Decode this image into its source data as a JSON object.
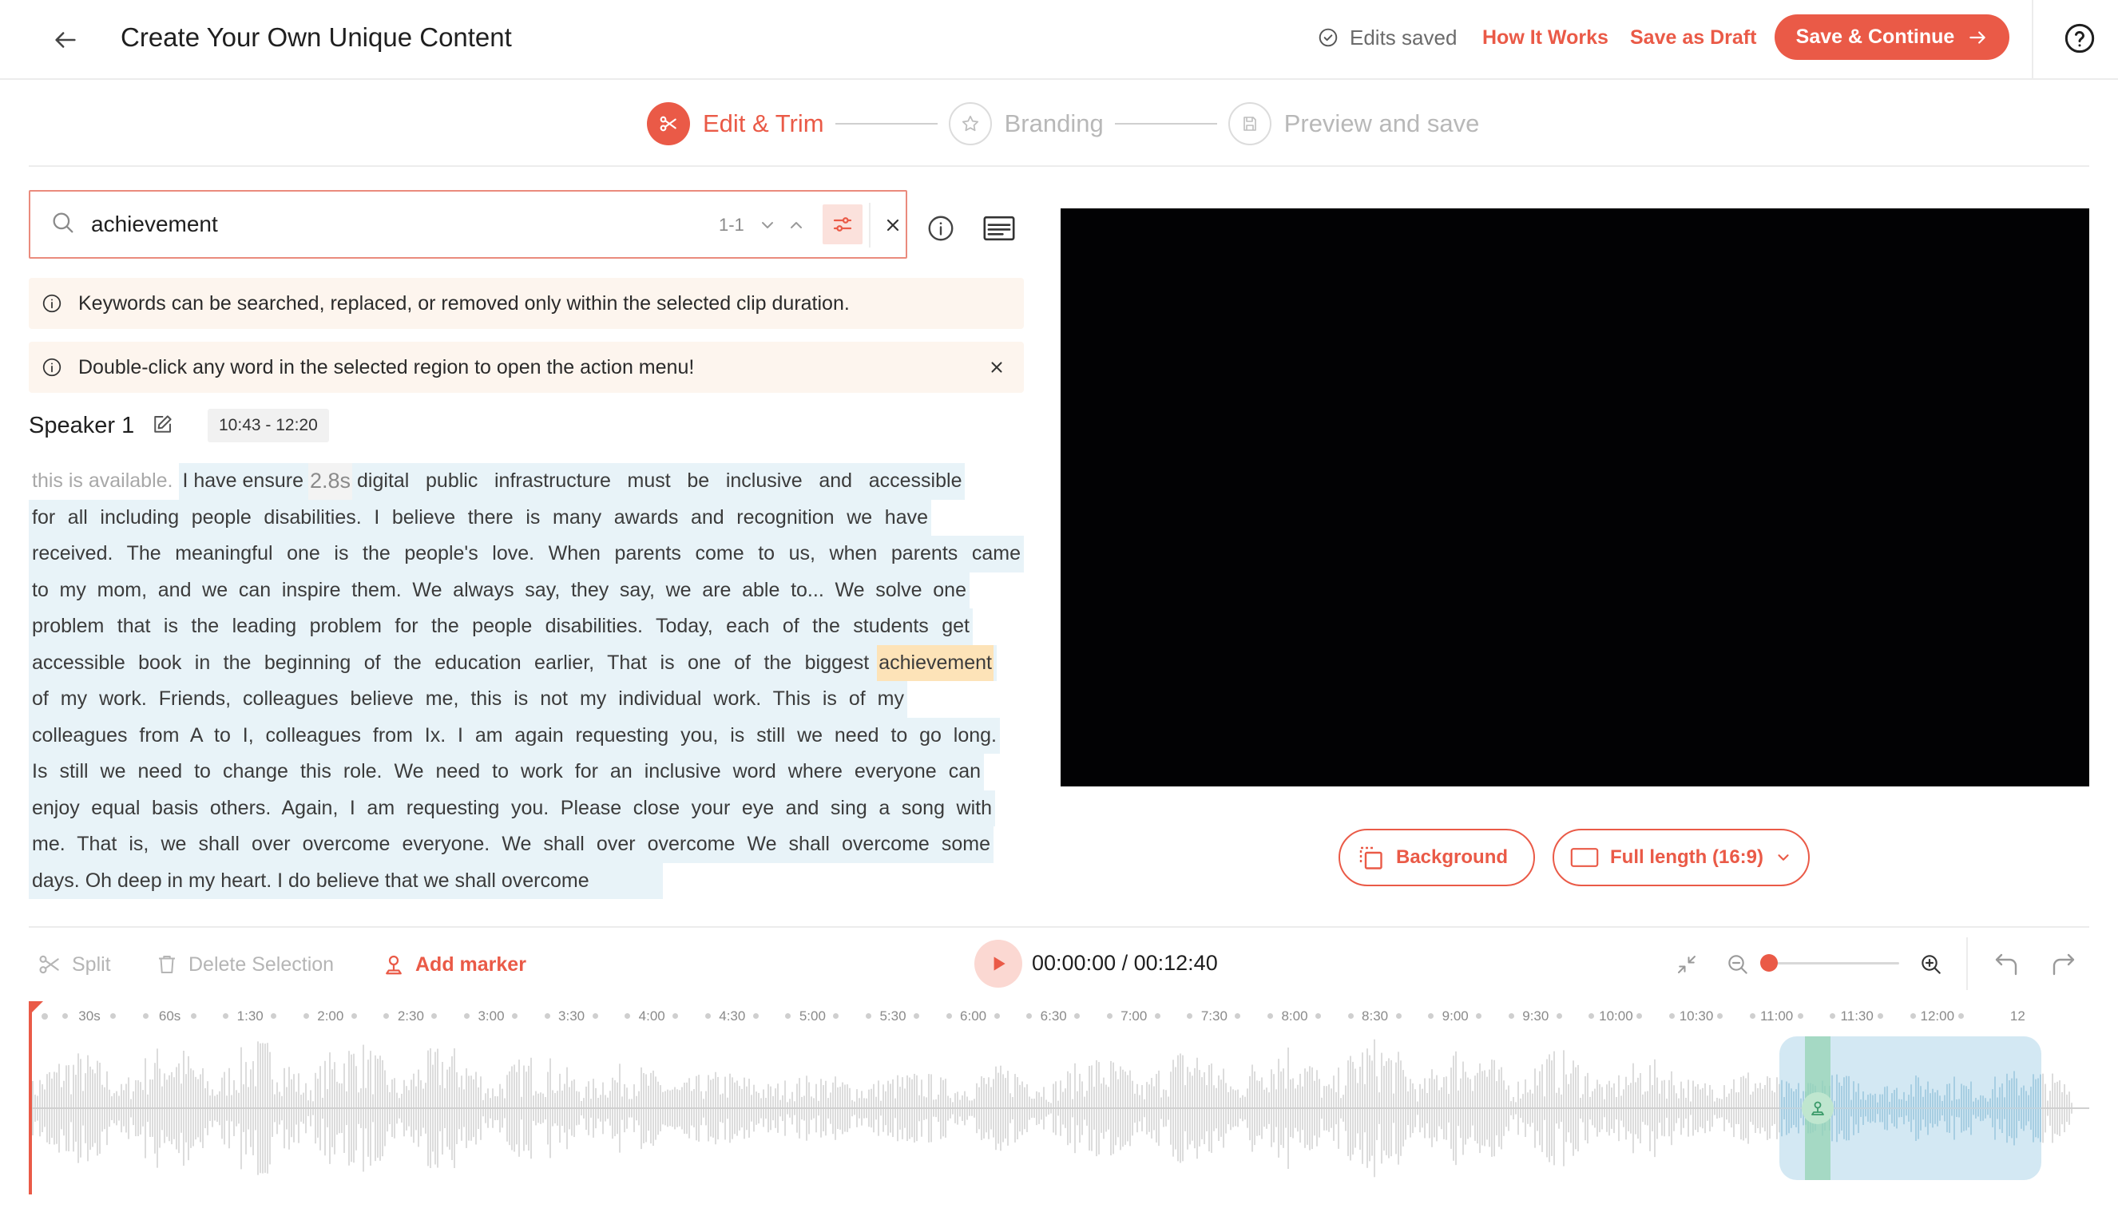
{
  "header": {
    "title": "Create Your Own Unique Content",
    "saved_status": "Edits saved",
    "how_it_works": "How It Works",
    "save_draft": "Save as Draft",
    "save_continue": "Save & Continue"
  },
  "steps": [
    {
      "label": "Edit & Trim",
      "state": "active"
    },
    {
      "label": "Branding",
      "state": "inactive"
    },
    {
      "label": "Preview and save",
      "state": "inactive"
    }
  ],
  "search": {
    "value": "achievement",
    "match_count": "1-1"
  },
  "notices": [
    {
      "text": "Keywords can be searched, replaced, or removed only within the selected clip duration."
    },
    {
      "text": "Double-click any word in the selected region to open the action menu!"
    }
  ],
  "speaker": {
    "name": "Speaker 1",
    "time_range": "10:43 - 12:20"
  },
  "transcript": {
    "line1_dim": "this is available.",
    "line1_a": "I have ensure",
    "line1_gap": "2.8s",
    "line1_b": "digital public infrastructure must be inclusive and accessible",
    "lines": [
      "for all including people disabilities. I believe there is many awards and recognition we have",
      "received. The meaningful one is the people's love. When parents come to us, when parents came",
      "to my mom, and we can inspire them. We always say, they say, we are able to... We solve one",
      "problem that is the leading problem for the people disabilities. Today, each of the students get"
    ],
    "line6_pre": "accessible book in the beginning of the education earlier, That is one of the biggest",
    "line6_kw": "achievement",
    "lines_after": [
      "of my work. Friends, colleagues believe me, this is not my individual work. This is of my",
      "colleagues from A to I, colleagues from Ix. I am again requesting you, is still we need to go long.",
      "Is still we need to change this role. We need to work for an inclusive word where everyone can",
      "enjoy equal basis others. Again, I am requesting you. Please close your eye and sing a song with",
      "me. That is, we shall over overcome everyone. We shall over overcome We shall overcome some",
      "days. Oh deep in my heart. I do believe that we shall overcome"
    ]
  },
  "video_controls": {
    "background": "Background",
    "aspect": "Full length (16:9)"
  },
  "toolbar": {
    "split": "Split",
    "delete": "Delete Selection",
    "add_marker": "Add marker",
    "time": "00:00:00 / 00:12:40",
    "zoom_level": 0.0
  },
  "timeline": {
    "ticks": [
      "30s",
      "60s",
      "1:30",
      "2:00",
      "2:30",
      "3:00",
      "3:30",
      "4:00",
      "4:30",
      "5:00",
      "5:30",
      "6:00",
      "6:30",
      "7:00",
      "7:30",
      "8:00",
      "8:30",
      "9:00",
      "9:30",
      "10:00",
      "10:30",
      "11:00",
      "11:30",
      "12:00",
      "12"
    ],
    "duration_seconds": 760,
    "selection_start": "10:43",
    "selection_end": "12:20"
  },
  "colors": {
    "accent": "#ea5a47",
    "selection": "#afd6ea",
    "keyword_highlight": "#fde3b8",
    "transcript_highlight": "#e8f3f8"
  }
}
